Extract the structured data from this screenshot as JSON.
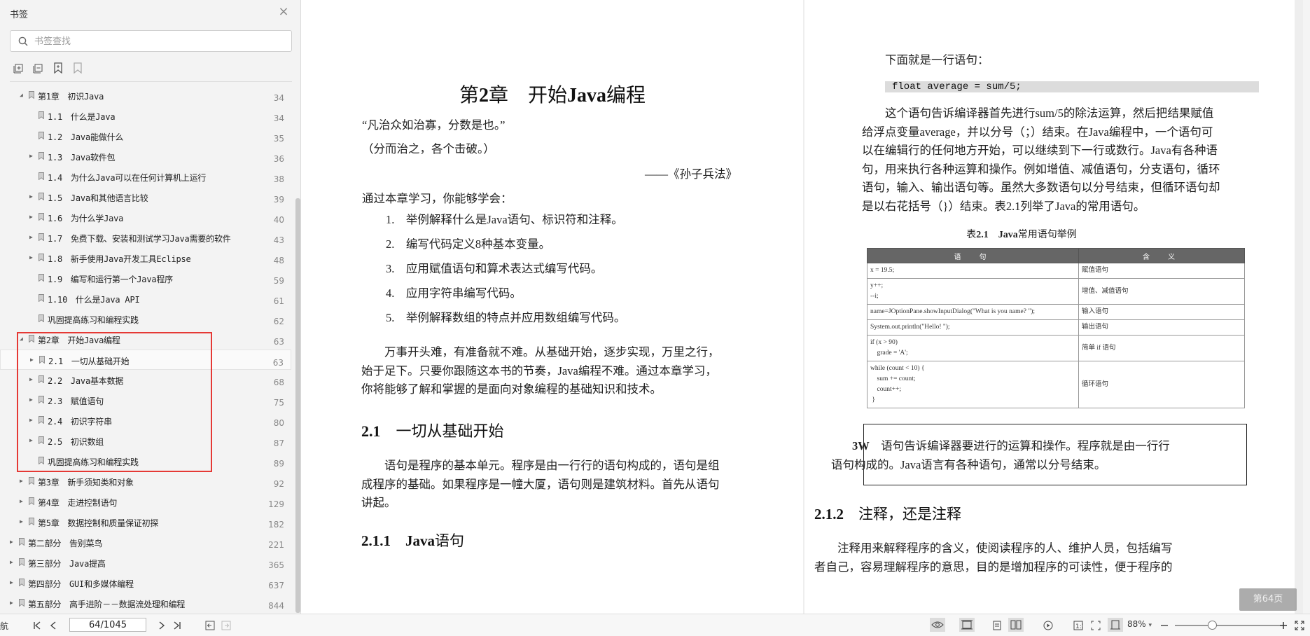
{
  "sidebar": {
    "title": "书签",
    "search_placeholder": "书签查找",
    "toc": [
      {
        "label": "第1章　初识Java",
        "page": "34",
        "level": 1,
        "arrow": "down"
      },
      {
        "label": "1.1　什么是Java",
        "page": "34",
        "level": 2,
        "arrow": ""
      },
      {
        "label": "1.2　Java能做什么",
        "page": "35",
        "level": 2,
        "arrow": ""
      },
      {
        "label": "1.3　Java软件包",
        "page": "36",
        "level": 2,
        "arrow": "right"
      },
      {
        "label": "1.4　为什么Java可以在任何计算机上运行",
        "page": "38",
        "level": 2,
        "arrow": ""
      },
      {
        "label": "1.5　Java和其他语言比较",
        "page": "39",
        "level": 2,
        "arrow": "right"
      },
      {
        "label": "1.6　为什么学Java",
        "page": "40",
        "level": 2,
        "arrow": "right"
      },
      {
        "label": "1.7　免费下载、安装和测试学习Java需要的软件",
        "page": "43",
        "level": 2,
        "arrow": "right"
      },
      {
        "label": "1.8　新手使用Java开发工具Eclipse",
        "page": "48",
        "level": 2,
        "arrow": "right"
      },
      {
        "label": "1.9　编写和运行第一个Java程序",
        "page": "59",
        "level": 2,
        "arrow": ""
      },
      {
        "label": "1.10　什么是Java API",
        "page": "61",
        "level": 2,
        "arrow": ""
      },
      {
        "label": "巩固提高练习和编程实践",
        "page": "62",
        "level": 2,
        "arrow": ""
      },
      {
        "label": "第2章　开始Java编程",
        "page": "63",
        "level": 1,
        "arrow": "down"
      },
      {
        "label": "2.1　一切从基础开始",
        "page": "63",
        "level": 2,
        "arrow": "right",
        "selected": true
      },
      {
        "label": "2.2　Java基本数据",
        "page": "68",
        "level": 2,
        "arrow": "right"
      },
      {
        "label": "2.3　赋值语句",
        "page": "75",
        "level": 2,
        "arrow": "right"
      },
      {
        "label": "2.4　初识字符串",
        "page": "80",
        "level": 2,
        "arrow": "right"
      },
      {
        "label": "2.5　初识数组",
        "page": "87",
        "level": 2,
        "arrow": "right"
      },
      {
        "label": "巩固提高练习和编程实践",
        "page": "89",
        "level": 2,
        "arrow": ""
      },
      {
        "label": "第3章　新手须知类和对象",
        "page": "92",
        "level": 1,
        "arrow": "right"
      },
      {
        "label": "第4章　走进控制语句",
        "page": "129",
        "level": 1,
        "arrow": "right"
      },
      {
        "label": "第5章　数据控制和质量保证初探",
        "page": "182",
        "level": 1,
        "arrow": "right"
      },
      {
        "label": "第二部分　告别菜鸟",
        "page": "221",
        "level": 0,
        "arrow": "right"
      },
      {
        "label": "第三部分　Java提高",
        "page": "365",
        "level": 0,
        "arrow": "right"
      },
      {
        "label": "第四部分　GUI和多媒体编程",
        "page": "637",
        "level": 0,
        "arrow": "right"
      },
      {
        "label": "第五部分　高手进阶－－数据流处理和编程",
        "page": "844",
        "level": 0,
        "arrow": "right"
      }
    ]
  },
  "left_page": {
    "chapter_prefix": "第",
    "chapter_num": "2",
    "chapter_mid": "章　开始",
    "chapter_java": "Java",
    "chapter_suffix": "编程",
    "quote1": "“凡治众如治寡，分数是也。”",
    "quote2": "（分而治之，各个击破。）",
    "quote_src": "——《孙子兵法》",
    "intro": "通过本章学习，你能够学会：",
    "goals": [
      "1.　举例解释什么是Java语句、标识符和注释。",
      "2.　编写代码定义8种基本变量。",
      "3.　应用赋值语句和算术表达式编写代码。",
      "4.　应用字符串编写代码。",
      "5.　举例解释数组的特点并应用数组编写代码。"
    ],
    "para1": [
      "　　万事开头难，有准备就不难。从基础开始，逐步实现，万里之行，",
      "始于足下。只要你跟随这本书的节奏，Java编程不难。通过本章学习，",
      "你将能够了解和掌握的是面向对象编程的基础知识和技术。"
    ],
    "h2_num": "2.1",
    "h2_text": "一切从基础开始",
    "para2": [
      "　　语句是程序的基本单元。程序是由一行行的语句构成的，语句是组",
      "成程序的基础。如果程序是一幢大厦，语句则是建筑材料。首先从语句",
      "讲起。"
    ],
    "h3_num": "2.1.1",
    "h3_java": "Java",
    "h3_text": "语句"
  },
  "right_page": {
    "line1": "　　下面就是一行语句：",
    "code": "float average = sum/5;",
    "para": [
      "　　这个语句告诉编译器首先进行sum/5的除法运算，然后把结果赋值",
      "给浮点变量average，并以分号（；）结束。在Java编程中，一个语句可",
      "以在编辑行的任何地方开始，可以继续到下一行或数行。Java有各种语",
      "句，用来执行各种运算和操作。例如增值、减值语句，分支语句，循环",
      "语句，输入、输出语句等。虽然大多数语句以分号结束，但循环语句却",
      "是以右花括号（}）结束。表2.1列举了Java的常用语句。"
    ],
    "table_caption_a": "表",
    "table_caption_b": "2.1",
    "table_caption_c": "　Java",
    "table_caption_d": "常用语句举例",
    "table_headers": [
      "语　句",
      "含　义"
    ],
    "table_rows": [
      {
        "code": "x = 19.5;",
        "meaning": "赋值语句"
      },
      {
        "code": "y++;\n--i;",
        "meaning": "增值、减值语句"
      },
      {
        "code": "name=JOptionPane.showInputDialog(\"What is you name? \");",
        "meaning": "输入语句"
      },
      {
        "code": "System.out.println(\"Hello! \");",
        "meaning": "输出语句"
      },
      {
        "code": "if (x > 90)\n    grade = 'A';",
        "meaning": "简单 if 语句"
      },
      {
        "code": "while (count < 10) {\n    sum += count;\n    count++;\n }",
        "meaning": "循环语句"
      }
    ],
    "note_label": "3W",
    "note_line1": "　语句告诉编译器要进行的运算和操作。程序就是由一行行",
    "note_line2": "语句构成的。Java语言有各种语句，通常以分号结束。",
    "h3_num": "2.1.2",
    "h3_text": "注释，还是注释",
    "para_last": [
      "　　注释用来解释程序的含义，使阅读程序的人、维护人员，包括编写",
      "者自己，容易理解程序的意思，目的是增加程序的可读性，便于程序的"
    ]
  },
  "statusbar": {
    "nav_label": "导航",
    "page_value": "64/1045",
    "zoom": "88%",
    "zoom_level": 0.35
  },
  "page_badge": "第64页",
  "colors": {
    "highlight": "#e53935",
    "sidebar_bg": "#f3f3f3"
  }
}
